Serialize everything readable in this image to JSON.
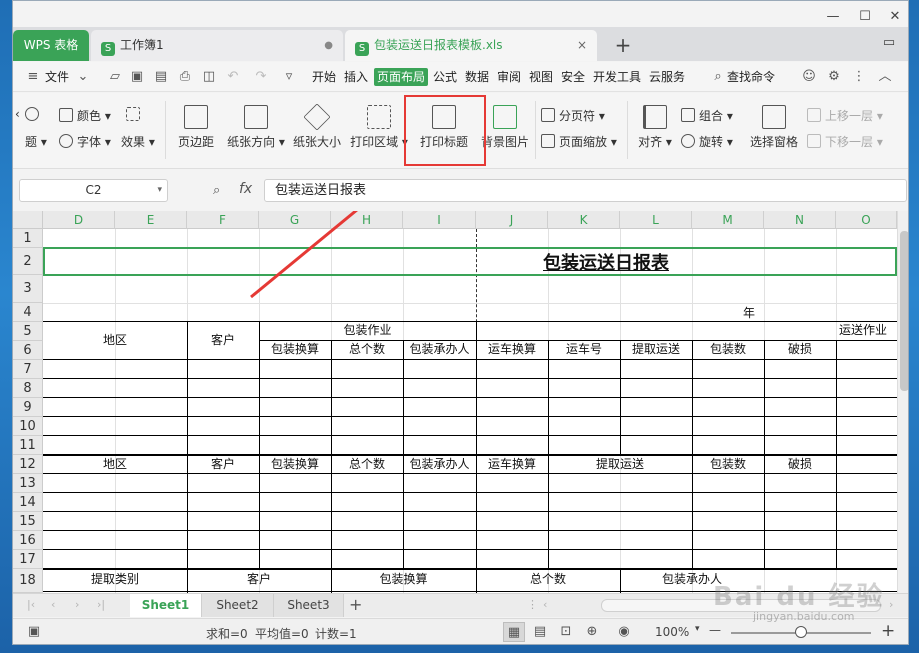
{
  "tabs": {
    "wps": "WPS 表格",
    "book": "工作簿1",
    "active": "包装运送日报表模板.xls",
    "book_dot": "●",
    "close": "×",
    "new": "+"
  },
  "menu": {
    "file": "文件",
    "items": [
      "开始",
      "插入",
      "页面布局",
      "公式",
      "数据",
      "审阅",
      "视图",
      "安全",
      "开发工具",
      "云服务"
    ],
    "active_index": 2,
    "search": "查找命令"
  },
  "ribbon": {
    "theme": "题",
    "color": "颜色",
    "font": "字体",
    "effect": "效果",
    "margin": "页边距",
    "orientation": "纸张方向",
    "size": "纸张大小",
    "print_area": "打印区域",
    "print_titles": "打印标题",
    "background": "背景图片",
    "page_break": "分页符",
    "page_zoom": "页面缩放",
    "align": "对齐",
    "group": "组合",
    "rotate": "旋转",
    "selection_pane": "选择窗格",
    "bring_forward": "上移一层",
    "send_backward": "下移一层"
  },
  "formula_bar": {
    "name_box": "C2",
    "fx": "fx",
    "content": "包装运送日报表"
  },
  "grid": {
    "columns": [
      "D",
      "E",
      "F",
      "G",
      "H",
      "I",
      "J",
      "K",
      "L",
      "M",
      "N",
      "O"
    ],
    "rows": [
      "1",
      "2",
      "3",
      "4",
      "5",
      "6",
      "7",
      "8",
      "9",
      "10",
      "11",
      "12",
      "13",
      "14",
      "15",
      "16",
      "17",
      "18"
    ],
    "title": "包装运送日报表",
    "year": "年",
    "header1": {
      "region": "地区",
      "customer": "客户",
      "pack_work": "包装作业",
      "ship_work": "运送作业",
      "pack_calc": "包装换算",
      "total": "总个数",
      "pack_handler": "包装承办人",
      "ship_calc": "运车换算",
      "truck_no": "运车号",
      "pickup": "提取运送",
      "pack_count": "包装数",
      "damage": "破损"
    },
    "header2": {
      "region": "地区",
      "customer": "客户",
      "pack_calc": "包装换算",
      "total": "总个数",
      "pack_handler": "包装承办人",
      "ship_calc": "运车换算",
      "pickup": "提取运送",
      "pack_count": "包装数",
      "damage": "破损"
    },
    "header3": {
      "pickup_type": "提取类别",
      "customer": "客户",
      "pack_calc": "包装换算",
      "total": "总个数",
      "pack_handler": "包装承办人"
    }
  },
  "sheets": [
    "Sheet1",
    "Sheet2",
    "Sheet3"
  ],
  "sheet_add": "+",
  "status": {
    "sum": "求和=0",
    "avg": "平均值=0",
    "count": "计数=1",
    "zoom": "100%",
    "zoom_minus": "—",
    "zoom_plus": "+"
  },
  "watermark": {
    "main": "Bai du 经验",
    "sub": "jingyan.baidu.com"
  },
  "colors": {
    "accent": "#3aa357",
    "highlight": "#e53935"
  }
}
